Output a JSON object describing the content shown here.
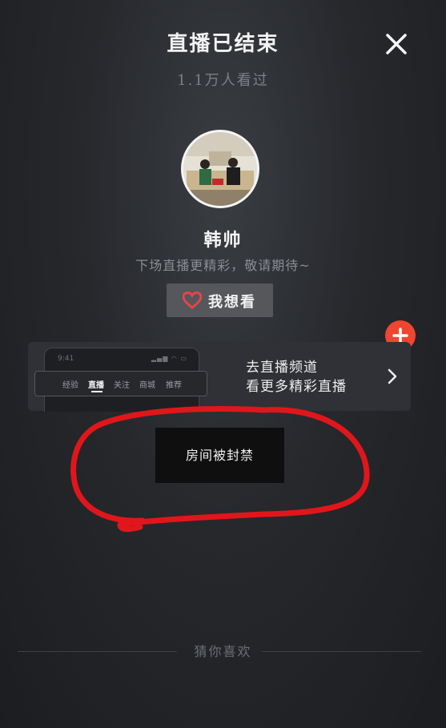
{
  "header": {
    "title": "直播已结束",
    "viewers": "1.1万人看过",
    "close_icon": "close-icon"
  },
  "host": {
    "name": "韩帅",
    "tagline": "下场直播更精彩，敬请期待~",
    "avatar_icon": "avatar",
    "follow_icon": "plus-icon"
  },
  "want_button": {
    "label": "我想看",
    "icon": "heart-icon"
  },
  "channel_banner": {
    "phone_time": "9:41",
    "tabs": [
      "经验",
      "直播",
      "关注",
      "商城",
      "推荐"
    ],
    "active_tab": "直播",
    "line1": "去直播频道",
    "line2": "看更多精彩直播",
    "chevron_icon": "chevron-right-icon"
  },
  "status": {
    "banned_text": "房间被封禁"
  },
  "recommend": {
    "label": "猜你喜欢"
  },
  "colors": {
    "follow_accent": "#f0452e",
    "heart": "#e8434a",
    "annotation": "#e0161b"
  }
}
